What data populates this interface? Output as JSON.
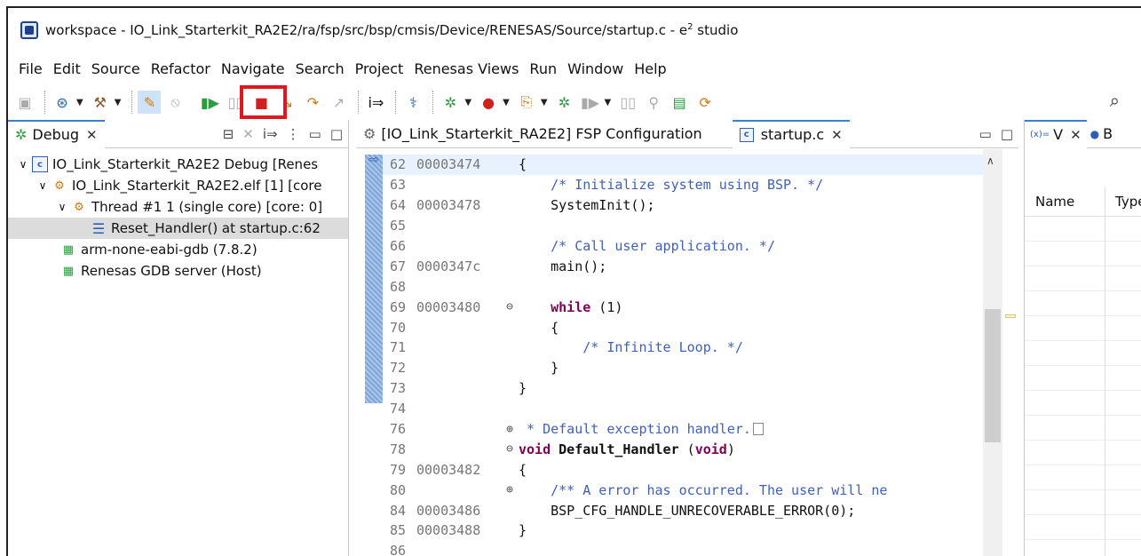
{
  "window": {
    "title": "workspace - IO_Link_Starterkit_RA2E2/ra/fsp/src/bsp/cmsis/Device/RENESAS/Source/startup.c - e",
    "title_sup": "2",
    "title_suffix": " studio"
  },
  "menu": [
    "File",
    "Edit",
    "Source",
    "Refactor",
    "Navigate",
    "Search",
    "Project",
    "Renesas Views",
    "Run",
    "Window",
    "Help"
  ],
  "debug_panel": {
    "tab_label": "Debug",
    "tree": [
      {
        "label": "IO_Link_Starterkit_RA2E2 Debug [Renes"
      },
      {
        "label": "IO_Link_Starterkit_RA2E2.elf [1] [core"
      },
      {
        "label": "Thread #1 1 (single core) [core: 0]"
      },
      {
        "label": "Reset_Handler() at startup.c:62"
      },
      {
        "label": "arm-none-eabi-gdb (7.8.2)"
      },
      {
        "label": "Renesas GDB server (Host)"
      }
    ]
  },
  "editor": {
    "tab_fsp": "[IO_Link_Starterkit_RA2E2] FSP Configuration",
    "tab_startup": "startup.c",
    "lines": [
      {
        "ln": "62",
        "addr": "00003474",
        "code": "{"
      },
      {
        "ln": "63",
        "addr": "",
        "code": "    /* Initialize system using BSP. */"
      },
      {
        "ln": "64",
        "addr": "00003478",
        "code": "    SystemInit();"
      },
      {
        "ln": "65",
        "addr": "",
        "code": ""
      },
      {
        "ln": "66",
        "addr": "",
        "code": "    /* Call user application. */"
      },
      {
        "ln": "67",
        "addr": "0000347c",
        "code": "    main();"
      },
      {
        "ln": "68",
        "addr": "",
        "code": ""
      },
      {
        "ln": "69",
        "addr": "00003480",
        "code_kw": "while",
        "code_rest": " (1)"
      },
      {
        "ln": "70",
        "addr": "",
        "code": "    {"
      },
      {
        "ln": "71",
        "addr": "",
        "code": "        /* Infinite Loop. */"
      },
      {
        "ln": "72",
        "addr": "",
        "code": "    }"
      },
      {
        "ln": "73",
        "addr": "",
        "code": "}"
      },
      {
        "ln": "74",
        "addr": "",
        "code": ""
      },
      {
        "ln": "76",
        "addr": "",
        "code": " * Default exception handler."
      },
      {
        "ln": "78",
        "addr": "",
        "code_kw": "void",
        "code_fn": "Default_Handler",
        "code_args": "void"
      },
      {
        "ln": "79",
        "addr": "00003482",
        "code": "{"
      },
      {
        "ln": "80",
        "addr": "",
        "code": "    /** A error has occurred. The user will ne"
      },
      {
        "ln": "84",
        "addr": "00003486",
        "code": "    BSP_CFG_HANDLE_UNRECOVERABLE_ERROR(0);"
      },
      {
        "ln": "85",
        "addr": "00003488",
        "code": "}"
      },
      {
        "ln": "86",
        "addr": "",
        "code": ""
      }
    ]
  },
  "variables_panel": {
    "tab_label": "V",
    "tab2_label": "B",
    "col_name": "Name",
    "col_type": "Type"
  }
}
